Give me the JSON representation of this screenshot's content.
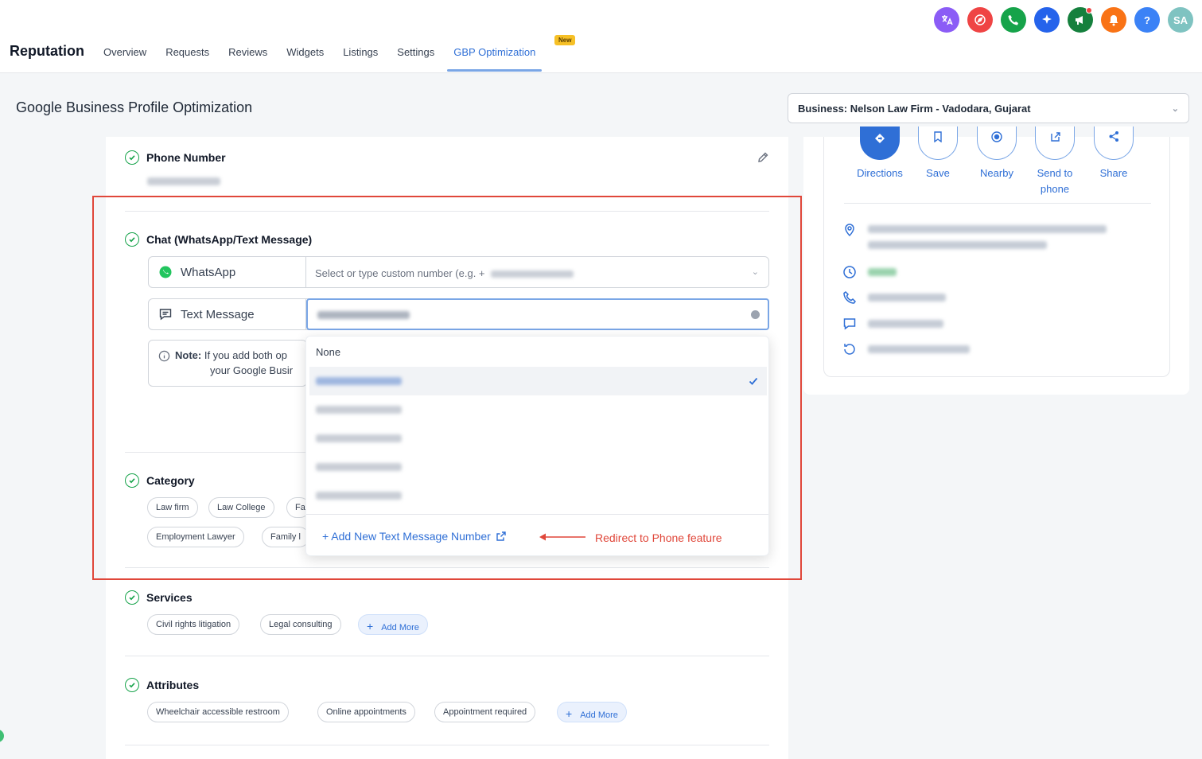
{
  "nav": {
    "brand": "Reputation",
    "items": [
      "Overview",
      "Requests",
      "Reviews",
      "Widgets",
      "Listings",
      "Settings",
      "GBP Optimization"
    ],
    "new_badge": "New"
  },
  "top_icons": {
    "avatar_initials": "SA",
    "colors": [
      "#8b5cf6",
      "#ef4444",
      "#16a34a",
      "#2563eb",
      "#15803d",
      "#f97316",
      "#3b82f6",
      "#7fc3c1"
    ]
  },
  "header": {
    "title": "Google Business Profile Optimization",
    "business_select": "Business: Nelson Law Firm - Vadodara, Gujarat"
  },
  "phone": {
    "title": "Phone Number"
  },
  "chat": {
    "title": "Chat (WhatsApp/Text Message)",
    "whatsapp_label": "WhatsApp",
    "whatsapp_placeholder": "Select or type custom number (e.g. +",
    "text_label": "Text Message",
    "note_label": "Note:",
    "note_line1": "If you add both op",
    "note_line2": "your Google Busir"
  },
  "dropdown": {
    "none_option": "None",
    "add_link": "+ Add New Text Message Number"
  },
  "annotation": {
    "text": "Redirect to Phone feature",
    "color": "#e0473a"
  },
  "category": {
    "title": "Category",
    "row1": [
      "Law firm",
      "Law College",
      "Fa"
    ],
    "row2": [
      "Employment Lawyer",
      "Family l"
    ]
  },
  "services": {
    "title": "Services",
    "chips": [
      "Civil rights litigation",
      "Legal consulting"
    ],
    "add": "Add More"
  },
  "attributes": {
    "title": "Attributes",
    "chips": [
      "Wheelchair accessible restroom",
      "Online appointments",
      "Appointment required"
    ],
    "add": "Add More"
  },
  "preview": {
    "actions": [
      "Directions",
      "Save",
      "Nearby",
      "Send to phone",
      "Share"
    ]
  },
  "accent": "#2f6fd6"
}
